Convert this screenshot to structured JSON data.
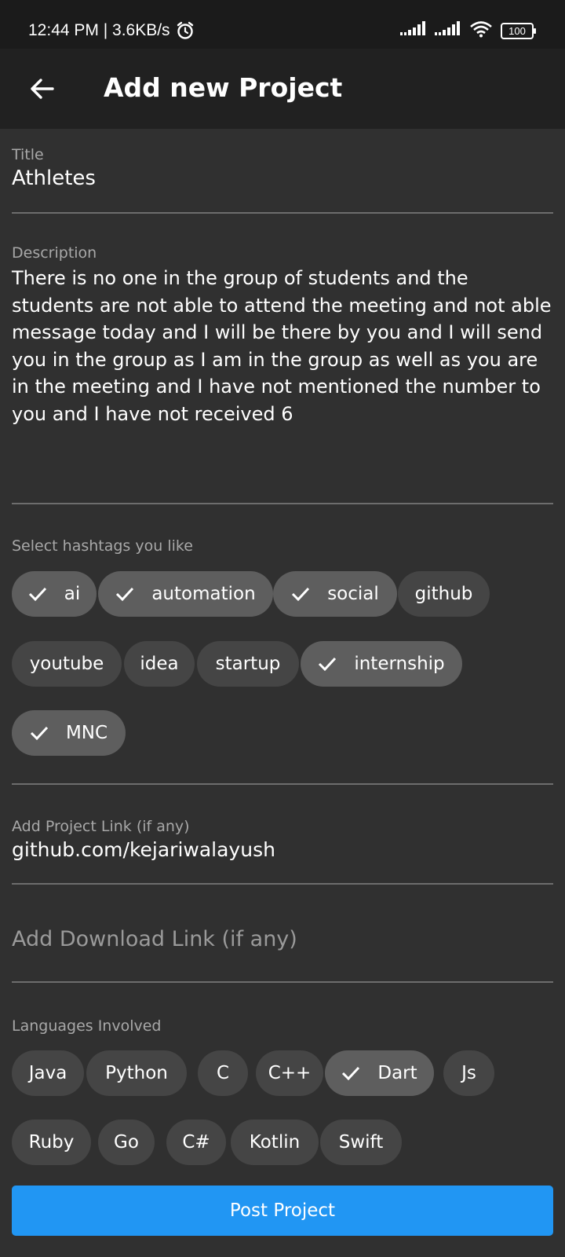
{
  "status_bar": {
    "time_speed": "12:44 PM | 3.6KB/s",
    "battery": "100",
    "icons": [
      "alarm-icon",
      "signal-icon",
      "signal-icon",
      "wifi-icon",
      "battery-icon"
    ]
  },
  "app_bar": {
    "title": "Add new Project",
    "back_icon": "arrow-left-icon"
  },
  "form": {
    "title_label": "Title",
    "title_value": "Athletes",
    "description_label": "Description",
    "description_value": "There is no one in the group of students and the students are not able to attend the meeting and not able message today and I will be there by you and I will send you in the group as I am in the group as well as you are in the meeting and I have not mentioned the number to you and I have not received 6",
    "hashtags_label": "Select hashtags you like",
    "hashtags": [
      {
        "label": "ai",
        "selected": true
      },
      {
        "label": "automation",
        "selected": true
      },
      {
        "label": "social",
        "selected": true
      },
      {
        "label": "github",
        "selected": false
      },
      {
        "label": "youtube",
        "selected": false
      },
      {
        "label": "idea",
        "selected": false
      },
      {
        "label": "startup",
        "selected": false
      },
      {
        "label": "internship",
        "selected": true
      },
      {
        "label": "MNC",
        "selected": true
      }
    ],
    "project_link_label": "Add Project Link (if any)",
    "project_link_value": "github.com/kejariwalayush",
    "download_link_placeholder": "Add Download Link (if any)",
    "languages_label": "Languages Involved",
    "languages": [
      {
        "label": "Java",
        "selected": false
      },
      {
        "label": "Python",
        "selected": false
      },
      {
        "label": "C",
        "selected": false
      },
      {
        "label": "C++",
        "selected": false
      },
      {
        "label": "Dart",
        "selected": true
      },
      {
        "label": "Js",
        "selected": false
      },
      {
        "label": "Ruby",
        "selected": false
      },
      {
        "label": "Go",
        "selected": false
      },
      {
        "label": "C#",
        "selected": false
      },
      {
        "label": "Kotlin",
        "selected": false
      },
      {
        "label": "Swift",
        "selected": false
      }
    ],
    "submit_label": "Post Project"
  },
  "colors": {
    "background": "#303030",
    "app_bar": "#212121",
    "status_bar": "#1b1b1b",
    "chip_selected": "#5e5e5e",
    "chip_unselected": "#454545",
    "primary_button": "#2196f3"
  }
}
